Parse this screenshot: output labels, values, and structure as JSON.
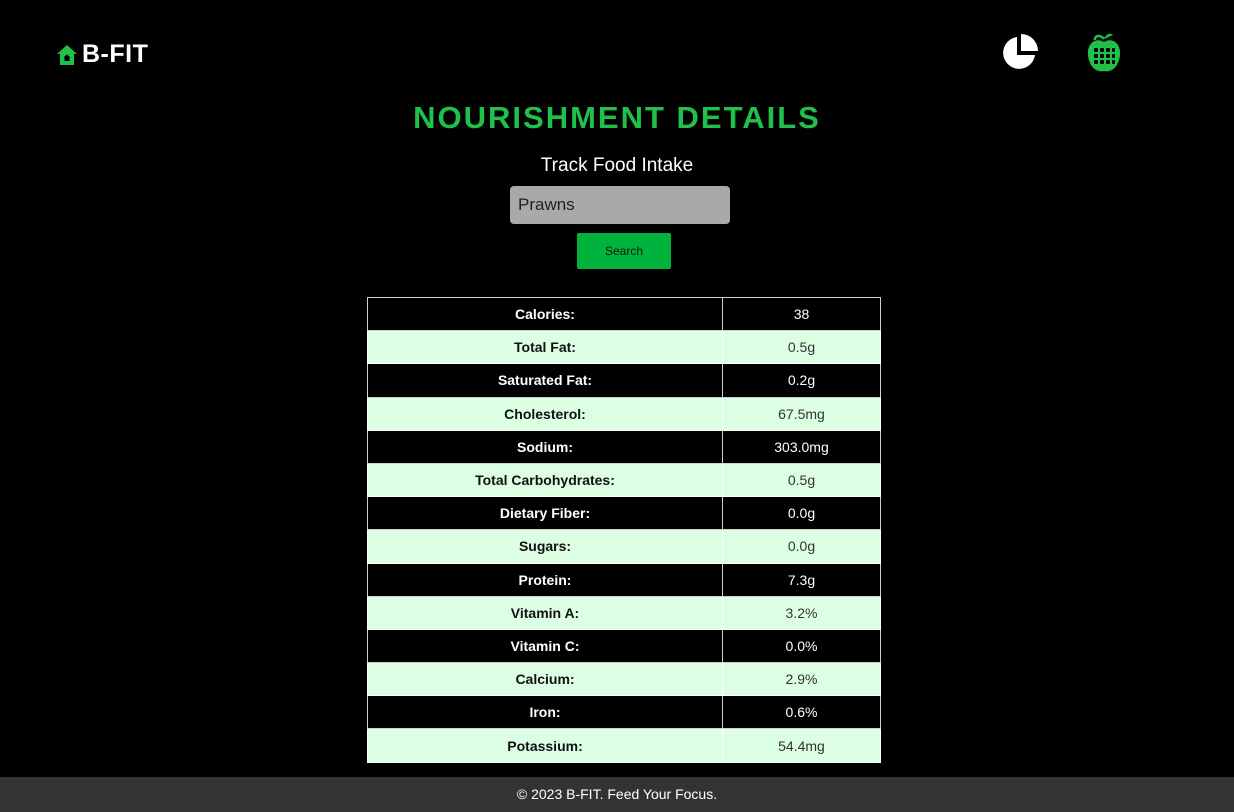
{
  "header": {
    "brand": "B-FIT",
    "icons": {
      "home": "home-icon",
      "chart": "pie-chart-icon",
      "calculator": "apple-calculator-icon"
    }
  },
  "main": {
    "title": "NOURISHMENT DETAILS",
    "subtitle": "Track Food Intake",
    "search": {
      "value": "Prawns",
      "placeholder": "",
      "button_label": "Search"
    },
    "nutrition": [
      {
        "label": "Calories:",
        "value": "38"
      },
      {
        "label": "Total Fat:",
        "value": "0.5g"
      },
      {
        "label": "Saturated Fat:",
        "value": "0.2g"
      },
      {
        "label": "Cholesterol:",
        "value": "67.5mg"
      },
      {
        "label": "Sodium:",
        "value": "303.0mg"
      },
      {
        "label": "Total Carbohydrates:",
        "value": "0.5g"
      },
      {
        "label": "Dietary Fiber:",
        "value": "0.0g"
      },
      {
        "label": "Sugars:",
        "value": "0.0g"
      },
      {
        "label": "Protein:",
        "value": "7.3g"
      },
      {
        "label": "Vitamin A:",
        "value": "3.2%"
      },
      {
        "label": "Vitamin C:",
        "value": "0.0%"
      },
      {
        "label": "Calcium:",
        "value": "2.9%"
      },
      {
        "label": "Iron:",
        "value": "0.6%"
      },
      {
        "label": "Potassium:",
        "value": "54.4mg"
      }
    ]
  },
  "footer": {
    "text": "© 2023 B-FIT. Feed Your Focus."
  },
  "colors": {
    "accent": "#1fc14b",
    "button": "#00b33c",
    "row_light": "#dcffe4",
    "row_dark": "#000000",
    "footer_bg": "#333333"
  }
}
